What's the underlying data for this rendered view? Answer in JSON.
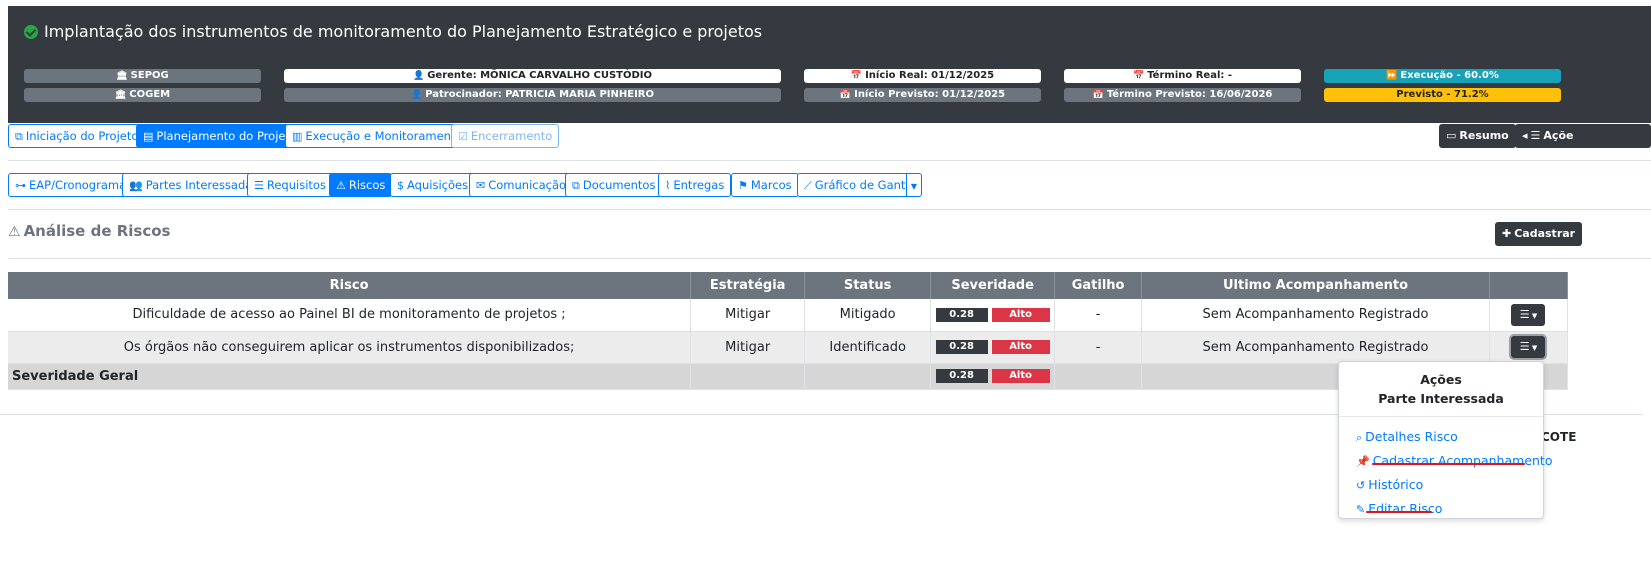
{
  "header": {
    "title": "Implantação dos instrumentos de monitoramento do Planejamento Estratégico e projetos",
    "row1": {
      "unit": "SEPOG",
      "manager": "Gerente: MÔNICA CARVALHO CUSTÓDIO",
      "start_real": "Início Real: 01/12/2025",
      "end_real": "Término Real: -",
      "execution": "Execução - 60.0%"
    },
    "row2": {
      "unit": "COGEM",
      "sponsor": "Patrocinador: PATRICIA MARIA PINHEIRO",
      "start_planned": "Início Previsto: 01/12/2025",
      "end_planned": "Término Previsto: 16/06/2026",
      "planned": "Previsto - 71.2%"
    }
  },
  "phase_tabs": [
    {
      "label": "Iniciação do Projeto",
      "state": "outline"
    },
    {
      "label": "Planejamento do Projeto",
      "state": "active"
    },
    {
      "label": "Execução e Monitoramento",
      "state": "outline"
    },
    {
      "label": "Encerramento",
      "state": "disabled"
    }
  ],
  "right_buttons": {
    "summary": "Resumo",
    "actions": "Açõe"
  },
  "module_tabs": [
    {
      "label": "EAP/Cronograma"
    },
    {
      "label": "Partes Interessadas"
    },
    {
      "label": "Requisitos"
    },
    {
      "label": "Riscos",
      "active": true
    },
    {
      "label": "Aquisições"
    },
    {
      "label": "Comunicação"
    },
    {
      "label": "Documentos"
    },
    {
      "label": "Entregas"
    },
    {
      "label": "Marcos"
    },
    {
      "label": "Gráfico de Gantt"
    }
  ],
  "section": {
    "title": "Análise de Riscos",
    "register_button": "Cadastrar"
  },
  "table": {
    "headers": [
      "Risco",
      "Estratégia",
      "Status",
      "Severidade",
      "Gatilho",
      "Ultimo Acompanhamento"
    ],
    "rows": [
      {
        "risk": "Dificuldade de acesso ao Painel BI de monitoramento de projetos ;",
        "strategy": "Mitigar",
        "status": "Mitigado",
        "severity": "0.28",
        "level": "Alto",
        "trigger": "-",
        "last": "Sem Acompanhamento Registrado"
      },
      {
        "risk": "Os órgãos não conseguirem aplicar os instrumentos disponibilizados;",
        "strategy": "Mitigar",
        "status": "Identificado",
        "severity": "0.28",
        "level": "Alto",
        "trigger": "-",
        "last": "Sem Acompanhamento Registrado"
      }
    ],
    "total": {
      "label": "Severidade Geral",
      "severity": "0.28",
      "level": "Alto"
    }
  },
  "dropdown": {
    "title": "Ações",
    "subtitle": "Parte Interessada",
    "items": [
      "Detalhes Risco",
      "Cadastrar Acompanhamento",
      "Histórico",
      "Editar Risco"
    ]
  },
  "cut_text": "COTE"
}
